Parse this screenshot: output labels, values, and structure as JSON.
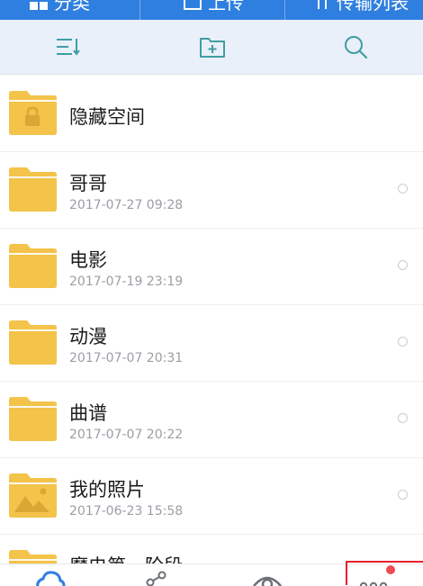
{
  "top_tabs": [
    {
      "label": "分类",
      "icon": "grid-icon"
    },
    {
      "label": "上传",
      "icon": "upload-icon"
    },
    {
      "label": "传输列表",
      "icon": "transfer-icon"
    }
  ],
  "toolbar": {
    "icons": [
      "sort-icon",
      "new-folder-icon",
      "search-icon"
    ]
  },
  "files": [
    {
      "name": "隐藏空间",
      "date": "",
      "type": "locked-folder"
    },
    {
      "name": "哥哥",
      "date": "2017-07-27  09:28",
      "type": "folder"
    },
    {
      "name": "电影",
      "date": "2017-07-19  23:19",
      "type": "folder"
    },
    {
      "name": "动漫",
      "date": "2017-07-07  20:31",
      "type": "folder"
    },
    {
      "name": "曲谱",
      "date": "2017-07-07  20:22",
      "type": "folder"
    },
    {
      "name": "我的照片",
      "date": "2017-06-23  15:58",
      "type": "photo-folder"
    },
    {
      "name": "魔电第一阶段",
      "date": "",
      "type": "folder"
    }
  ],
  "bottom_nav": [
    {
      "name": "files",
      "icon": "cloud-icon"
    },
    {
      "name": "share",
      "icon": "share-icon"
    },
    {
      "name": "discover",
      "icon": "eye-icon"
    },
    {
      "name": "more",
      "icon": "more-icon",
      "badge": true
    }
  ],
  "colors": {
    "header_blue": "#2f7fe0",
    "folder_yellow": "#f3c34a",
    "toolbar_bg": "#e9f0f9",
    "badge_red": "#f0494f",
    "highlight_red": "#e8202a"
  }
}
